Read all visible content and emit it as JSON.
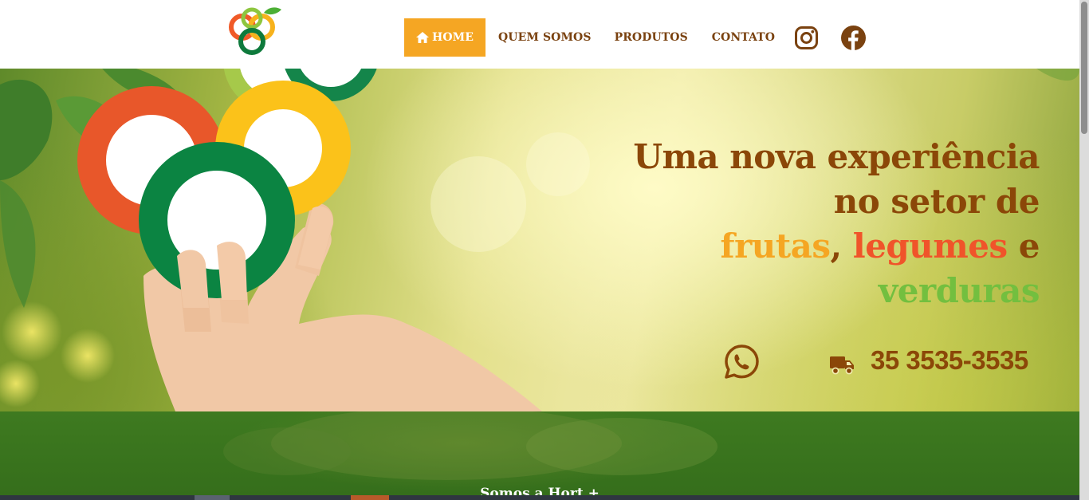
{
  "header": {
    "logo_alt": "Hort+",
    "nav": [
      {
        "label": "HOME",
        "active": true,
        "icon": "home-icon"
      },
      {
        "label": "QUEM SOMOS"
      },
      {
        "label": "PRODUTOS"
      },
      {
        "label": "CONTATO"
      }
    ],
    "social": [
      {
        "name": "instagram",
        "icon": "instagram-icon"
      },
      {
        "name": "facebook",
        "icon": "facebook-icon"
      }
    ]
  },
  "hero": {
    "headline_line1": "Uma nova experiência",
    "headline_line2": "no setor de",
    "word_frutas": "frutas",
    "sep_comma": ",",
    "word_legumes": "legumes",
    "word_e": "e",
    "word_verduras": "verduras",
    "phone": "35 3535-3535",
    "whatsapp_icon": "whatsapp-icon",
    "truck_icon": "truck-icon"
  },
  "about": {
    "title": "Somos a Hort +"
  },
  "colors": {
    "brand_brown": "#8b4708",
    "accent_orange": "#f5a623",
    "accent_red": "#f0542a",
    "accent_green": "#73bf3f",
    "band_green": "#3e7a20"
  }
}
